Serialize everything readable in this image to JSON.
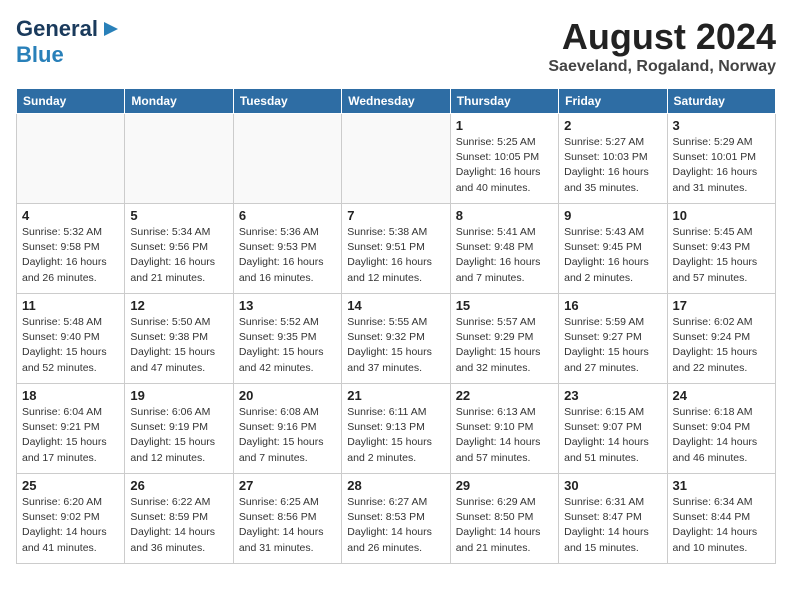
{
  "header": {
    "logo_general": "General",
    "logo_blue": "Blue",
    "month": "August 2024",
    "location": "Saeveland, Rogaland, Norway"
  },
  "days_of_week": [
    "Sunday",
    "Monday",
    "Tuesday",
    "Wednesday",
    "Thursday",
    "Friday",
    "Saturday"
  ],
  "weeks": [
    [
      {
        "day": "",
        "info": ""
      },
      {
        "day": "",
        "info": ""
      },
      {
        "day": "",
        "info": ""
      },
      {
        "day": "",
        "info": ""
      },
      {
        "day": "1",
        "info": "Sunrise: 5:25 AM\nSunset: 10:05 PM\nDaylight: 16 hours\nand 40 minutes."
      },
      {
        "day": "2",
        "info": "Sunrise: 5:27 AM\nSunset: 10:03 PM\nDaylight: 16 hours\nand 35 minutes."
      },
      {
        "day": "3",
        "info": "Sunrise: 5:29 AM\nSunset: 10:01 PM\nDaylight: 16 hours\nand 31 minutes."
      }
    ],
    [
      {
        "day": "4",
        "info": "Sunrise: 5:32 AM\nSunset: 9:58 PM\nDaylight: 16 hours\nand 26 minutes."
      },
      {
        "day": "5",
        "info": "Sunrise: 5:34 AM\nSunset: 9:56 PM\nDaylight: 16 hours\nand 21 minutes."
      },
      {
        "day": "6",
        "info": "Sunrise: 5:36 AM\nSunset: 9:53 PM\nDaylight: 16 hours\nand 16 minutes."
      },
      {
        "day": "7",
        "info": "Sunrise: 5:38 AM\nSunset: 9:51 PM\nDaylight: 16 hours\nand 12 minutes."
      },
      {
        "day": "8",
        "info": "Sunrise: 5:41 AM\nSunset: 9:48 PM\nDaylight: 16 hours\nand 7 minutes."
      },
      {
        "day": "9",
        "info": "Sunrise: 5:43 AM\nSunset: 9:45 PM\nDaylight: 16 hours\nand 2 minutes."
      },
      {
        "day": "10",
        "info": "Sunrise: 5:45 AM\nSunset: 9:43 PM\nDaylight: 15 hours\nand 57 minutes."
      }
    ],
    [
      {
        "day": "11",
        "info": "Sunrise: 5:48 AM\nSunset: 9:40 PM\nDaylight: 15 hours\nand 52 minutes."
      },
      {
        "day": "12",
        "info": "Sunrise: 5:50 AM\nSunset: 9:38 PM\nDaylight: 15 hours\nand 47 minutes."
      },
      {
        "day": "13",
        "info": "Sunrise: 5:52 AM\nSunset: 9:35 PM\nDaylight: 15 hours\nand 42 minutes."
      },
      {
        "day": "14",
        "info": "Sunrise: 5:55 AM\nSunset: 9:32 PM\nDaylight: 15 hours\nand 37 minutes."
      },
      {
        "day": "15",
        "info": "Sunrise: 5:57 AM\nSunset: 9:29 PM\nDaylight: 15 hours\nand 32 minutes."
      },
      {
        "day": "16",
        "info": "Sunrise: 5:59 AM\nSunset: 9:27 PM\nDaylight: 15 hours\nand 27 minutes."
      },
      {
        "day": "17",
        "info": "Sunrise: 6:02 AM\nSunset: 9:24 PM\nDaylight: 15 hours\nand 22 minutes."
      }
    ],
    [
      {
        "day": "18",
        "info": "Sunrise: 6:04 AM\nSunset: 9:21 PM\nDaylight: 15 hours\nand 17 minutes."
      },
      {
        "day": "19",
        "info": "Sunrise: 6:06 AM\nSunset: 9:19 PM\nDaylight: 15 hours\nand 12 minutes."
      },
      {
        "day": "20",
        "info": "Sunrise: 6:08 AM\nSunset: 9:16 PM\nDaylight: 15 hours\nand 7 minutes."
      },
      {
        "day": "21",
        "info": "Sunrise: 6:11 AM\nSunset: 9:13 PM\nDaylight: 15 hours\nand 2 minutes."
      },
      {
        "day": "22",
        "info": "Sunrise: 6:13 AM\nSunset: 9:10 PM\nDaylight: 14 hours\nand 57 minutes."
      },
      {
        "day": "23",
        "info": "Sunrise: 6:15 AM\nSunset: 9:07 PM\nDaylight: 14 hours\nand 51 minutes."
      },
      {
        "day": "24",
        "info": "Sunrise: 6:18 AM\nSunset: 9:04 PM\nDaylight: 14 hours\nand 46 minutes."
      }
    ],
    [
      {
        "day": "25",
        "info": "Sunrise: 6:20 AM\nSunset: 9:02 PM\nDaylight: 14 hours\nand 41 minutes."
      },
      {
        "day": "26",
        "info": "Sunrise: 6:22 AM\nSunset: 8:59 PM\nDaylight: 14 hours\nand 36 minutes."
      },
      {
        "day": "27",
        "info": "Sunrise: 6:25 AM\nSunset: 8:56 PM\nDaylight: 14 hours\nand 31 minutes."
      },
      {
        "day": "28",
        "info": "Sunrise: 6:27 AM\nSunset: 8:53 PM\nDaylight: 14 hours\nand 26 minutes."
      },
      {
        "day": "29",
        "info": "Sunrise: 6:29 AM\nSunset: 8:50 PM\nDaylight: 14 hours\nand 21 minutes."
      },
      {
        "day": "30",
        "info": "Sunrise: 6:31 AM\nSunset: 8:47 PM\nDaylight: 14 hours\nand 15 minutes."
      },
      {
        "day": "31",
        "info": "Sunrise: 6:34 AM\nSunset: 8:44 PM\nDaylight: 14 hours\nand 10 minutes."
      }
    ]
  ]
}
